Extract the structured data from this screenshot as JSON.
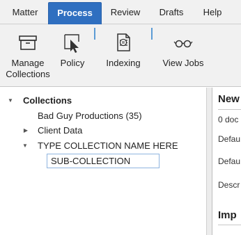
{
  "tabs": [
    {
      "label": "Matter",
      "active": false
    },
    {
      "label": "Process",
      "active": true
    },
    {
      "label": "Review",
      "active": false
    },
    {
      "label": "Drafts",
      "active": false
    },
    {
      "label": "Help",
      "active": false
    }
  ],
  "ribbon": {
    "manage_collections": {
      "label_line1": "Manage",
      "label_line2": "Collections",
      "icon": "archive-box-icon"
    },
    "policy": {
      "label": "Policy",
      "icon": "cursor-icon"
    },
    "indexing": {
      "label": "Indexing",
      "icon": "document-list-icon"
    },
    "view_jobs": {
      "label": "View Jobs",
      "icon": "glasses-icon"
    }
  },
  "tree": {
    "root_label": "Collections",
    "items": [
      {
        "label": "Bad Guy Productions (35)"
      },
      {
        "label": "Client Data"
      },
      {
        "label": "TYPE COLLECTION NAME HERE"
      }
    ],
    "sub_input_value": "SUB-COLLECTION"
  },
  "details": {
    "heading": "New",
    "doc_count": "0 doc",
    "field1": "Defau",
    "field2": "Defau",
    "field3": "Descr",
    "section_heading": "Imp"
  },
  "colors": {
    "accent": "#2f6fc0",
    "separator": "#5b9bd5",
    "input_border": "#8fb4df"
  }
}
